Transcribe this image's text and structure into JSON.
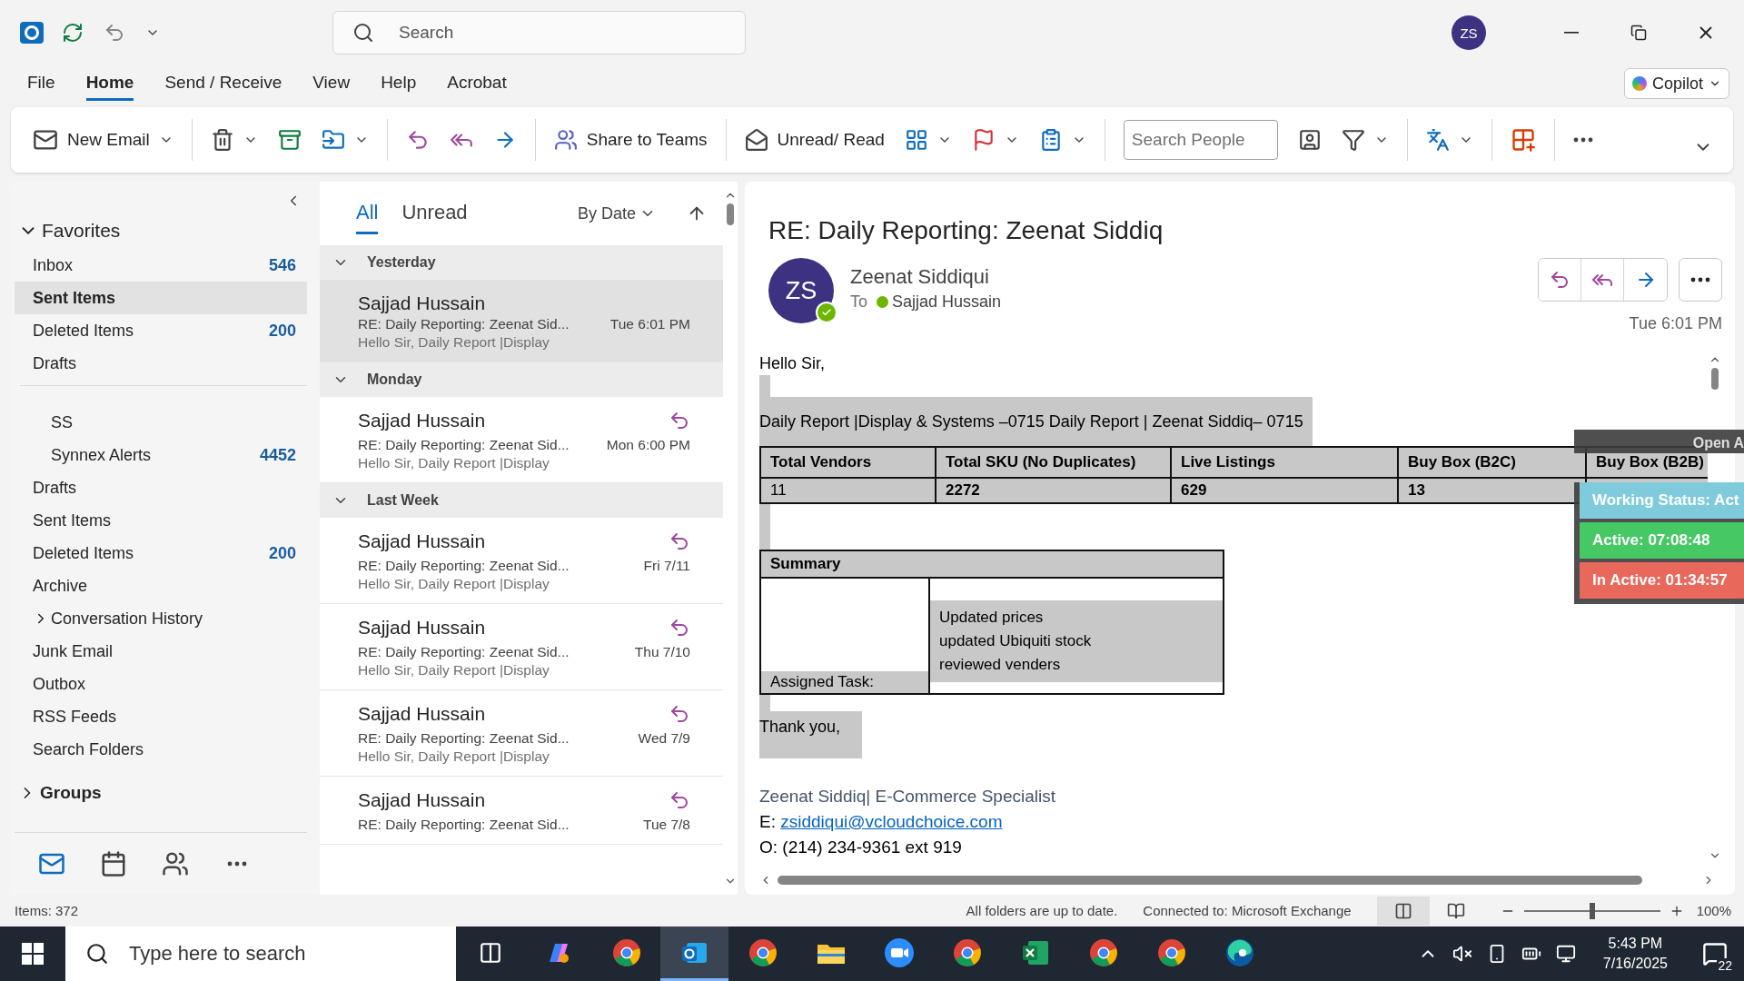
{
  "title_bar": {
    "search_placeholder": "Search",
    "avatar": "ZS"
  },
  "menu_tabs": [
    {
      "label": "File",
      "selected": false
    },
    {
      "label": "Home",
      "selected": true
    },
    {
      "label": "Send / Receive",
      "selected": false
    },
    {
      "label": "View",
      "selected": false
    },
    {
      "label": "Help",
      "selected": false
    },
    {
      "label": "Acrobat",
      "selected": false
    }
  ],
  "copilot": {
    "label": "Copilot"
  },
  "ribbon": [
    {
      "kind": "button",
      "label": "New Email",
      "dropdown": true
    },
    {
      "kind": "separator"
    },
    {
      "kind": "icon",
      "dropdown": true
    },
    {
      "kind": "icon",
      "dropdown": false
    },
    {
      "kind": "icon",
      "dropdown": true
    },
    {
      "kind": "separator"
    },
    {
      "kind": "icon",
      "dropdown": false
    },
    {
      "kind": "icon",
      "dropdown": false
    },
    {
      "kind": "icon",
      "dropdown": false
    },
    {
      "kind": "separator"
    },
    {
      "kind": "button",
      "label": "Share to Teams",
      "dropdown": false
    },
    {
      "kind": "separator"
    },
    {
      "kind": "button",
      "label": "Unread/ Read",
      "dropdown": false
    },
    {
      "kind": "icon",
      "dropdown": true
    },
    {
      "kind": "icon",
      "dropdown": true
    },
    {
      "kind": "icon",
      "dropdown": true
    },
    {
      "kind": "separator"
    },
    {
      "kind": "search",
      "placeholder": "Search People"
    },
    {
      "kind": "icon",
      "dropdown": false
    },
    {
      "kind": "icon",
      "dropdown": true
    },
    {
      "kind": "separator"
    },
    {
      "kind": "icon",
      "dropdown": true
    },
    {
      "kind": "separator"
    },
    {
      "kind": "icon",
      "dropdown": false
    },
    {
      "kind": "separator"
    },
    {
      "kind": "icon",
      "dropdown": false
    }
  ],
  "folder_pane": {
    "favorites": {
      "label": "Favorites",
      "expanded": true,
      "items": [
        {
          "label": "Inbox",
          "count": "546",
          "selected": false
        },
        {
          "label": "Sent Items",
          "selected": true
        },
        {
          "label": "Deleted Items",
          "count": "200",
          "selected": false
        },
        {
          "label": "Drafts",
          "selected": false
        }
      ]
    },
    "folders": [
      {
        "children": [
          {
            "label": "SS",
            "selected": false
          },
          {
            "label": "Synnex Alerts",
            "count": "4452",
            "selected": false
          }
        ]
      },
      {
        "label": "Drafts",
        "selected": false
      },
      {
        "label": "Sent Items",
        "selected": false
      },
      {
        "label": "Deleted Items",
        "count": "200",
        "selected": false
      },
      {
        "label": "Archive",
        "selected": false
      },
      {
        "label": "Conversation History",
        "expanded": false,
        "selected": false
      },
      {
        "label": "Junk Email",
        "selected": false
      },
      {
        "label": "Outbox",
        "selected": false
      },
      {
        "label": "RSS Feeds",
        "selected": false
      },
      {
        "label": "Search Folders",
        "selected": false
      }
    ],
    "groups": {
      "label": "Groups",
      "expanded": false
    }
  },
  "nav": [
    {
      "kind": "mail",
      "selected": true
    },
    {
      "kind": "calendar",
      "selected": false
    },
    {
      "kind": "people",
      "selected": false
    },
    {
      "kind": "more",
      "selected": false
    }
  ],
  "message_list": {
    "tabs": [
      {
        "label": "All",
        "selected": true
      },
      {
        "label": "Unread",
        "selected": false
      }
    ],
    "sort": "By Date",
    "groups": [
      {
        "label": "Yesterday",
        "expanded": true,
        "messages": [
          {
            "sender": "Sajjad Hussain",
            "subject": "RE: Daily Reporting: Zeenat Sid...",
            "preview": "Hello Sir,  Daily Report |Display",
            "date": "Tue 6:01 PM",
            "replied": false,
            "selected": true
          }
        ]
      },
      {
        "label": "Monday",
        "expanded": true,
        "messages": [
          {
            "sender": "Sajjad Hussain",
            "subject": "RE: Daily Reporting: Zeenat Sid...",
            "preview": "Hello Sir,  Daily Report |Display",
            "date": "Mon 6:00 PM",
            "replied": true,
            "selected": false
          }
        ]
      },
      {
        "label": "Last Week",
        "expanded": true,
        "messages": [
          {
            "sender": "Sajjad Hussain",
            "subject": "RE: Daily Reporting: Zeenat Sid...",
            "preview": "Hello Sir,  Daily Report |Display",
            "date": "Fri 7/11",
            "replied": true,
            "selected": false
          },
          {
            "sender": "Sajjad Hussain",
            "subject": "RE: Daily Reporting: Zeenat Sid...",
            "preview": "Hello Sir,  Daily Report |Display",
            "date": "Thu 7/10",
            "replied": true,
            "selected": false
          },
          {
            "sender": "Sajjad Hussain",
            "subject": "RE: Daily Reporting: Zeenat Sid...",
            "preview": "Hello Sir,  Daily Report |Display",
            "date": "Wed 7/9",
            "replied": true,
            "selected": false
          },
          {
            "sender": "Sajjad Hussain",
            "subject": "RE: Daily Reporting: Zeenat Sid...",
            "date": "Tue 7/8",
            "replied": true,
            "selected": false
          }
        ]
      }
    ]
  },
  "reading_pane": {
    "subject": "RE: Daily Reporting: Zeenat Siddiq",
    "avatar": "ZS",
    "sender": "Zeenat Siddiqui",
    "to_label": "To",
    "recipient": "Sajjad Hussain",
    "time": "Tue 6:01 PM",
    "body": {
      "greeting": "Hello Sir,",
      "report_title": "Daily Report |Display & Systems –0715 Daily Report | Zeenat Siddiq– 0715",
      "stats_table": {
        "columns": [
          "Total Vendors",
          "Total SKU (No Duplicates)",
          "Live Listings",
          "Buy Box (B2C)",
          "Buy Box (B2B)"
        ],
        "rows": [
          [
            "11",
            "2272",
            "629",
            "13"
          ]
        ]
      },
      "summary": {
        "title": "Summary",
        "label": "Assigned Task:",
        "tasks": [
          "Updated prices",
          "updated Ubiquiti stock",
          "reviewed venders"
        ]
      },
      "closing": "Thank you,",
      "signature": {
        "name_line": "Zeenat Siddiq| E-Commerce Specialist",
        "email_label": "E:",
        "email": "zsiddiqui@vcloudchoice.com",
        "phone": "O: (214) 234-9361 ext 919"
      }
    }
  },
  "status_overlay": {
    "header": "Open A",
    "items": [
      {
        "label": "Working Status: Act",
        "color": "#7fcbdc"
      },
      {
        "label": "Active: 07:08:48",
        "color": "#46c964"
      },
      {
        "label": "In Active: 01:34:57",
        "color": "#e8695c"
      }
    ]
  },
  "status_bar": {
    "items_count": "Items: 372",
    "sync": "All folders are up to date.",
    "connection": "Connected to: Microsoft Exchange",
    "views": [
      {
        "kind": "normal",
        "selected": true
      },
      {
        "kind": "reading",
        "selected": false
      }
    ],
    "zoom": {
      "level": 0.5,
      "label": "100%"
    }
  },
  "taskbar": {
    "search_placeholder": "Type here to search",
    "apps": [
      {
        "kind": "taskview",
        "selected": false
      },
      {
        "kind": "copilot",
        "selected": false
      },
      {
        "kind": "chrome",
        "selected": false
      },
      {
        "kind": "outlook",
        "selected": true
      },
      {
        "kind": "chrome",
        "selected": false
      },
      {
        "kind": "folder",
        "selected": false
      },
      {
        "kind": "zoom",
        "selected": false
      },
      {
        "kind": "chrome",
        "selected": false
      },
      {
        "kind": "excel",
        "selected": false
      },
      {
        "kind": "chrome",
        "selected": false
      },
      {
        "kind": "chrome",
        "selected": false
      },
      {
        "kind": "edge",
        "selected": false
      }
    ],
    "time": "5:43 PM",
    "date": "7/16/2025",
    "notifications": "22"
  }
}
